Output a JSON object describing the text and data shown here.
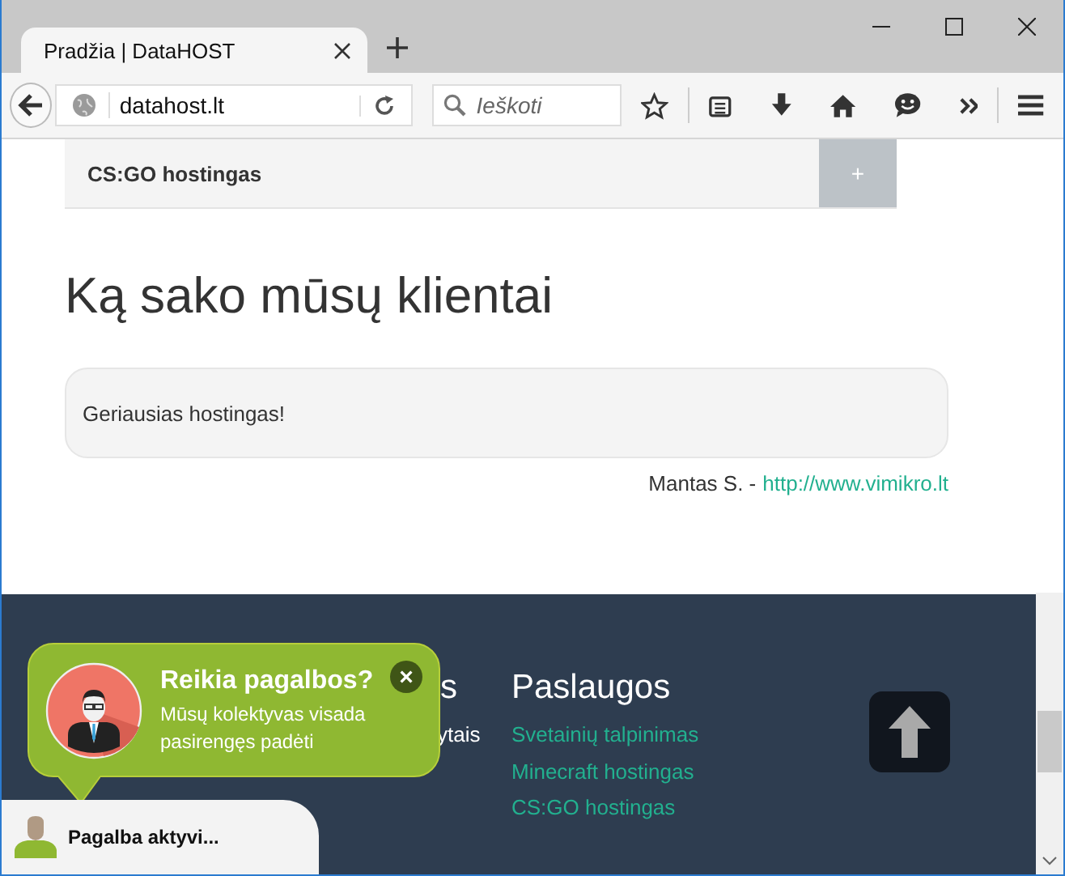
{
  "browser": {
    "tab_title": "Pradžia | DataHOST",
    "address": "datahost.lt",
    "search_placeholder": "Ieškoti"
  },
  "accordion": {
    "title": "CS:GO hostingas",
    "toggle": "+"
  },
  "testimonials": {
    "heading": "Ką sako mūsų klientai",
    "quote": "Geriausias hostingas!",
    "author": "Mantas S. -",
    "link": "http://www.vimikro.lt"
  },
  "footer": {
    "column_1": {
      "heading_fragment": "s",
      "text_fragment": "ytais"
    },
    "services": {
      "heading": "Paslaugos",
      "links": [
        "Svetainių talpinimas",
        "Minecraft hostingas",
        "CS:GO hostingas"
      ]
    }
  },
  "help_popup": {
    "title": "Reikia pagalbos?",
    "message": "Mūsų kolektyvas visada pasirengęs padėti",
    "close": "×"
  },
  "chat_bar": {
    "status": "Pagalba aktyvi..."
  }
}
